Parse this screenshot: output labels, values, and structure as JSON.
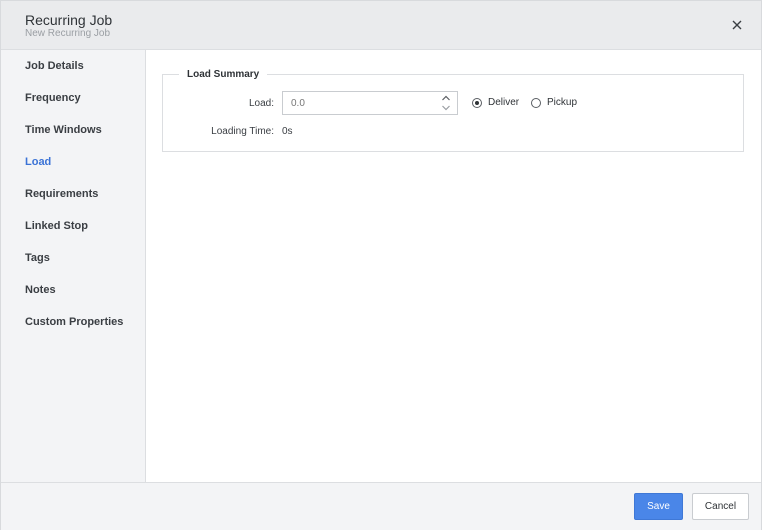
{
  "dialog": {
    "title": "Recurring Job",
    "subtitle": "New Recurring Job",
    "close_icon": "close-icon"
  },
  "sidebar": {
    "items": [
      {
        "label": "Job Details",
        "active": false
      },
      {
        "label": "Frequency",
        "active": false
      },
      {
        "label": "Time Windows",
        "active": false
      },
      {
        "label": "Load",
        "active": true
      },
      {
        "label": "Requirements",
        "active": false
      },
      {
        "label": "Linked Stop",
        "active": false
      },
      {
        "label": "Tags",
        "active": false
      },
      {
        "label": "Notes",
        "active": false
      },
      {
        "label": "Custom Properties",
        "active": false
      }
    ]
  },
  "load_summary": {
    "legend": "Load Summary",
    "load_label": "Load:",
    "load_value": "0.0",
    "deliver_label": "Deliver",
    "pickup_label": "Pickup",
    "selected_option": "Deliver",
    "loading_time_label": "Loading Time:",
    "loading_time_value": "0s"
  },
  "footer": {
    "save_label": "Save",
    "cancel_label": "Cancel"
  },
  "colors": {
    "accent": "#4a86e8",
    "active_nav": "#3b73d6",
    "header_bg": "#eaebed",
    "sidebar_bg": "#f3f4f6"
  }
}
